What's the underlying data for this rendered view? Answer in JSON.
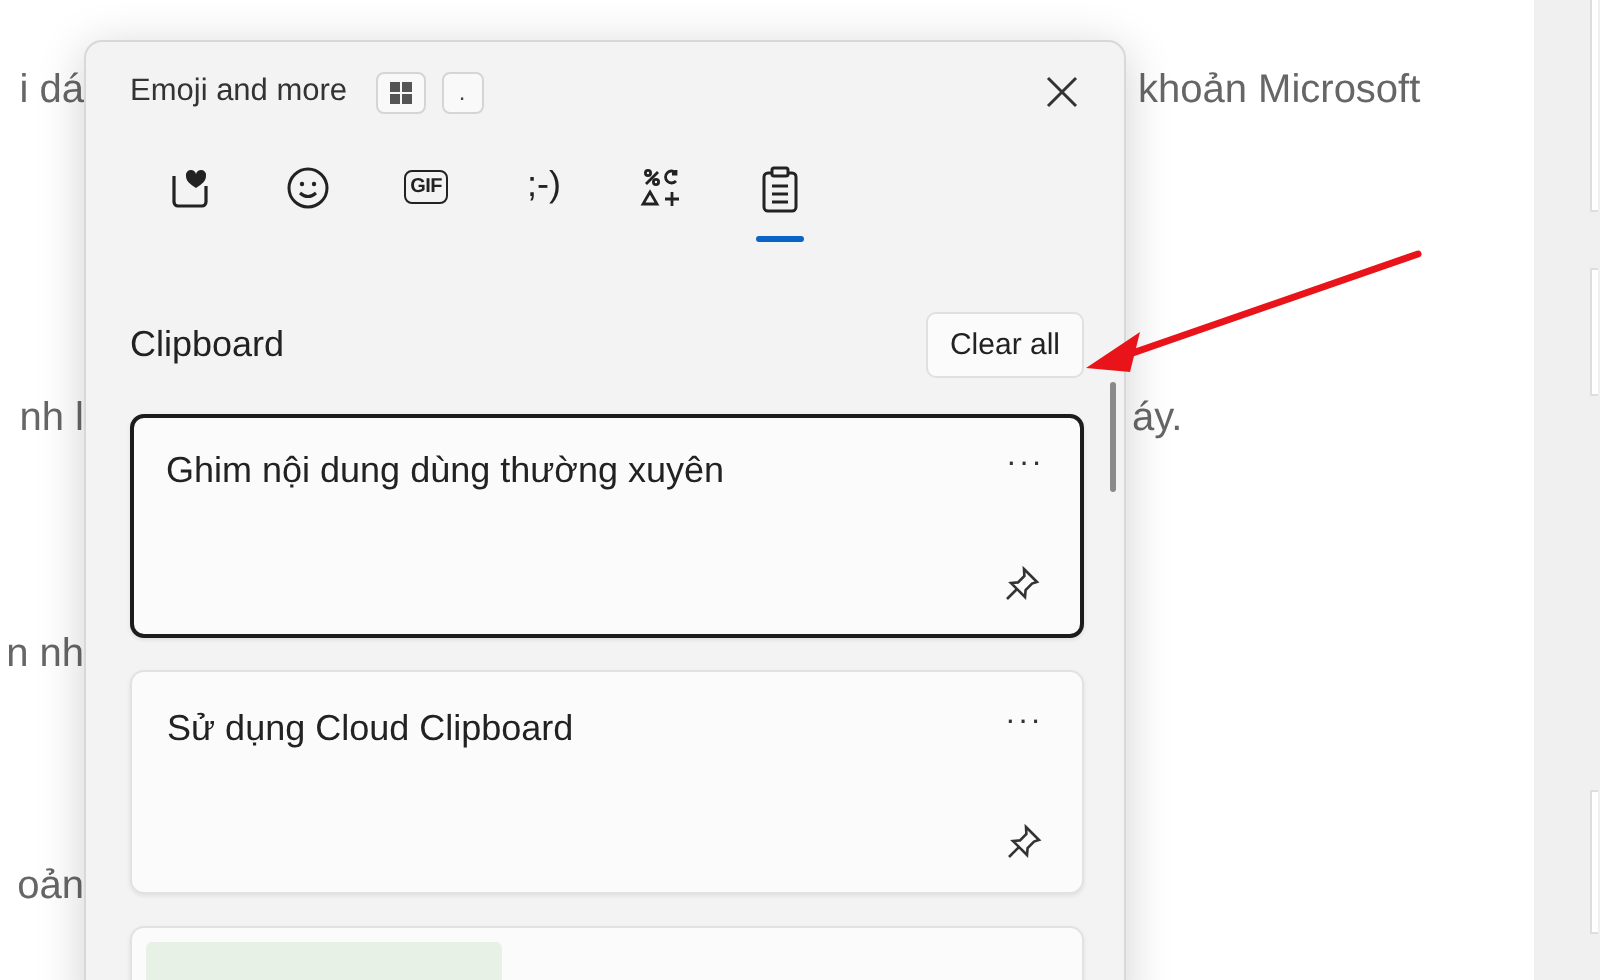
{
  "document": {
    "left_fragments": [
      "i dá",
      "nh l",
      "n nh",
      "oản"
    ],
    "right_fragments": [
      "khoản Microsoft",
      "áy."
    ]
  },
  "panel": {
    "title": "Emoji and more",
    "key_hint": ".",
    "tabs": [
      {
        "kind": "favorites",
        "selected": false
      },
      {
        "kind": "emoji",
        "selected": false
      },
      {
        "kind": "gif",
        "label": "GIF",
        "selected": false
      },
      {
        "kind": "kaomoji",
        "label": ";-)",
        "selected": false
      },
      {
        "kind": "symbols",
        "selected": false
      },
      {
        "kind": "clipboard",
        "selected": true
      }
    ],
    "section_title": "Clipboard",
    "clear_button": "Clear all",
    "clips": [
      {
        "kind": "text",
        "text": "Ghim nội dung dùng thường xuyên",
        "more": "···",
        "selected": true
      },
      {
        "kind": "text",
        "text": "Sử dụng Cloud Clipboard",
        "more": "···",
        "selected": false
      },
      {
        "kind": "image",
        "selected": false
      }
    ]
  }
}
